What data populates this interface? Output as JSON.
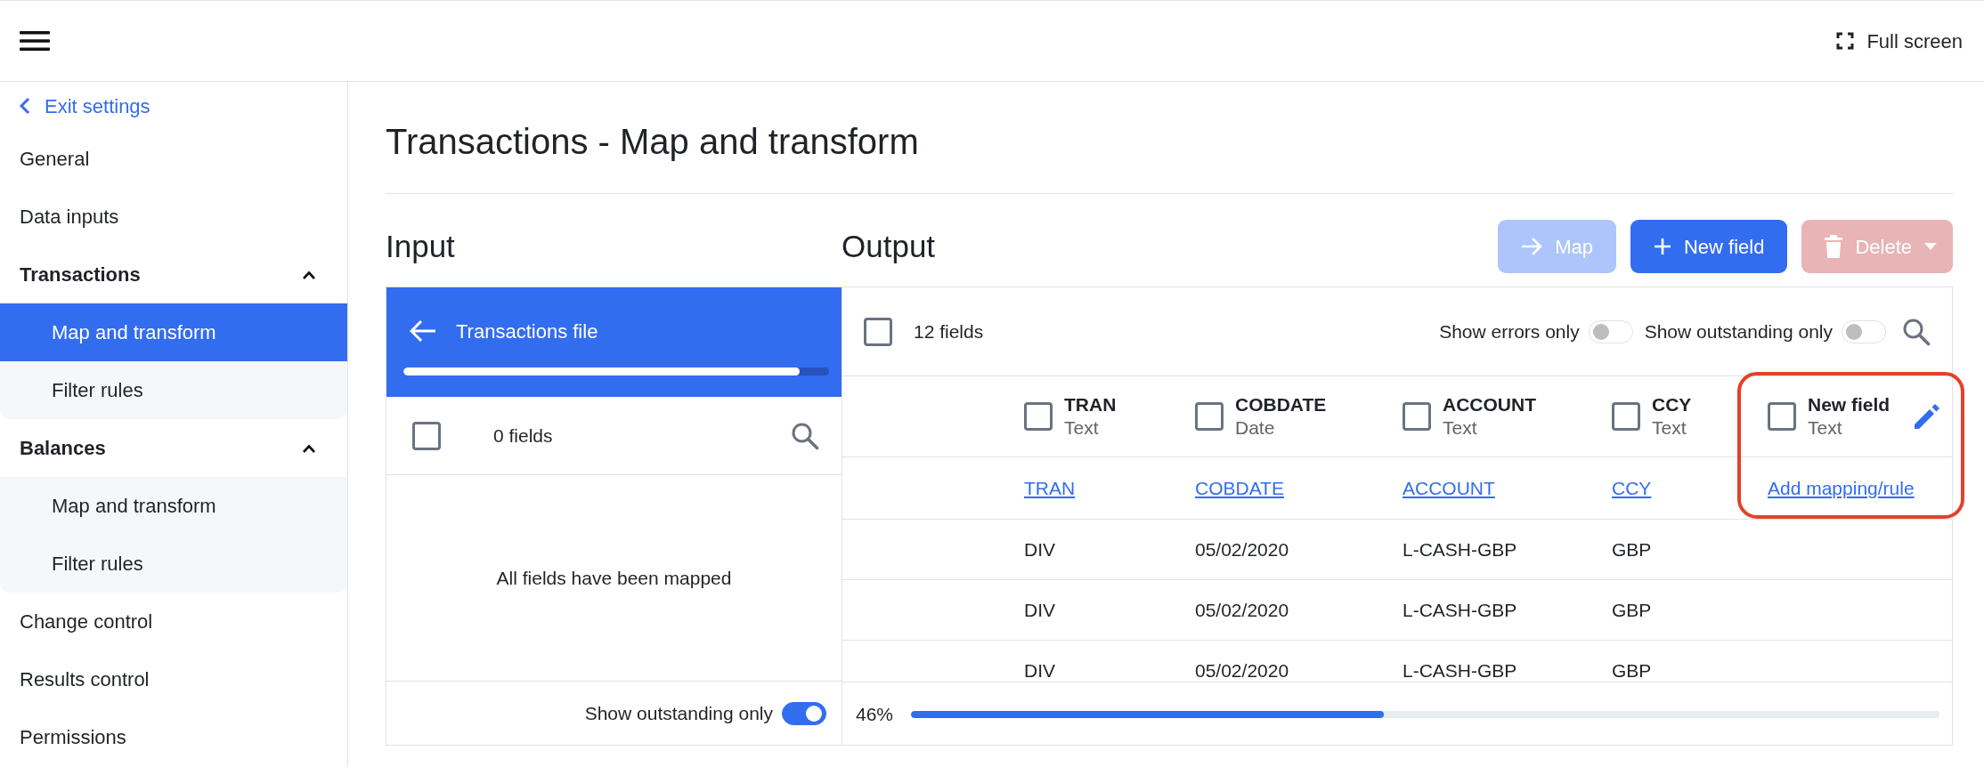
{
  "top_bar": {
    "fullscreen": "Full screen"
  },
  "sidebar": {
    "back": "Exit settings",
    "items": [
      {
        "kind": "item",
        "label": "General",
        "selected": false
      },
      {
        "kind": "item",
        "label": "Data inputs",
        "selected": false
      },
      {
        "kind": "group",
        "label": "Transactions",
        "expanded": true,
        "children": [
          {
            "label": "Map and transform",
            "selected": true
          },
          {
            "label": "Filter rules",
            "selected": false
          }
        ]
      },
      {
        "kind": "group",
        "label": "Balances",
        "expanded": true,
        "children": [
          {
            "label": "Map and transform",
            "selected": false
          },
          {
            "label": "Filter rules",
            "selected": false
          }
        ]
      },
      {
        "kind": "item",
        "label": "Change control",
        "selected": false
      },
      {
        "kind": "item",
        "label": "Results control",
        "selected": false
      },
      {
        "kind": "item",
        "label": "Permissions",
        "selected": false
      }
    ]
  },
  "page": {
    "title": "Transactions - Map and transform"
  },
  "input": {
    "heading": "Input",
    "file": {
      "name": "Transactions file",
      "level": 0.93
    },
    "select_all": {
      "checked": false
    },
    "count": "0 fields",
    "empty_message": "All fields have been mapped",
    "toggle": {
      "label": "Show outstanding only",
      "on": true
    }
  },
  "output": {
    "heading": "Output",
    "buttons": [
      {
        "kind": "map",
        "label": "Map",
        "disabled": true
      },
      {
        "kind": "new",
        "label": "New field",
        "disabled": false
      },
      {
        "kind": "delete",
        "label": "Delete",
        "disabled": true
      }
    ],
    "select_all": {
      "checked": false
    },
    "count": "12 fields",
    "toggles": [
      {
        "label": "Show errors only",
        "on": false
      },
      {
        "label": "Show outstanding only",
        "on": false
      }
    ],
    "columns": [
      {
        "name": "TRAN",
        "type": "Text",
        "mapping": "TRAN",
        "checked": false,
        "editable": false,
        "highlighted": false
      },
      {
        "name": "COBDATE",
        "type": "Date",
        "mapping": "COBDATE",
        "checked": false,
        "editable": false,
        "highlighted": false
      },
      {
        "name": "ACCOUNT",
        "type": "Text",
        "mapping": "ACCOUNT",
        "checked": false,
        "editable": false,
        "highlighted": false
      },
      {
        "name": "CCY",
        "type": "Text",
        "mapping": "CCY",
        "checked": false,
        "editable": false,
        "highlighted": false
      },
      {
        "name": "New field",
        "type": "Text",
        "mapping": "Add mapping/rule",
        "checked": false,
        "editable": true,
        "highlighted": true
      }
    ],
    "rows": [
      [
        "DIV",
        "05/02/2020",
        "L-CASH-GBP",
        "GBP"
      ],
      [
        "DIV",
        "05/02/2020",
        "L-CASH-GBP",
        "GBP"
      ],
      [
        "DIV",
        "05/02/2020",
        "L-CASH-GBP",
        "GBP"
      ]
    ],
    "progress": {
      "reading": "46%",
      "level": 0.46
    }
  }
}
